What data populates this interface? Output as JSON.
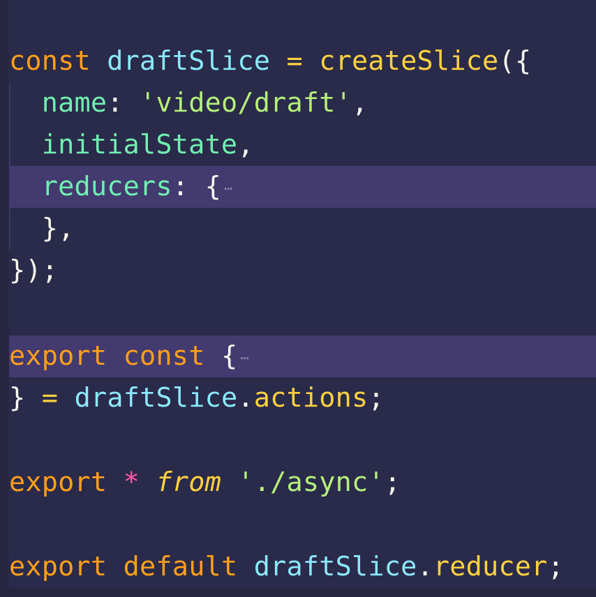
{
  "colors": {
    "background": "#2a2a4a",
    "highlight_line": "#433a70",
    "keyword": "#ff9f1a",
    "identifier": "#8be9fd",
    "function": "#ffd23f",
    "property": "#6ff0b0",
    "string": "#b5f07a",
    "punctuation": "#f8f8f2",
    "operator_star": "#ff5ca8"
  },
  "code": {
    "l1": {
      "kw": "const",
      "name": "draftSlice",
      "eq": "=",
      "fn": "createSlice",
      "open": "({"
    },
    "l2": {
      "prop": "name",
      "colon": ":",
      "str": "'video/draft'",
      "comma": ","
    },
    "l3": {
      "prop": "initialState",
      "comma": ","
    },
    "l4": {
      "prop": "reducers",
      "colon": ":",
      "brace": "{",
      "fold": "⋯"
    },
    "l5": {
      "text": "},"
    },
    "l6": {
      "text": "});"
    },
    "l8": {
      "kw1": "export",
      "kw2": "const",
      "brace": "{",
      "fold": "⋯"
    },
    "l9": {
      "close": "}",
      "eq": "=",
      "obj": "draftSlice",
      "dot": ".",
      "prop": "actions",
      "semi": ";"
    },
    "l11": {
      "kw": "export",
      "star": "*",
      "from": "from",
      "str": "'./async'",
      "semi": ";"
    },
    "l13": {
      "kw1": "export",
      "kw2": "default",
      "obj": "draftSlice",
      "dot": ".",
      "prop": "reducer",
      "semi": ";"
    }
  }
}
